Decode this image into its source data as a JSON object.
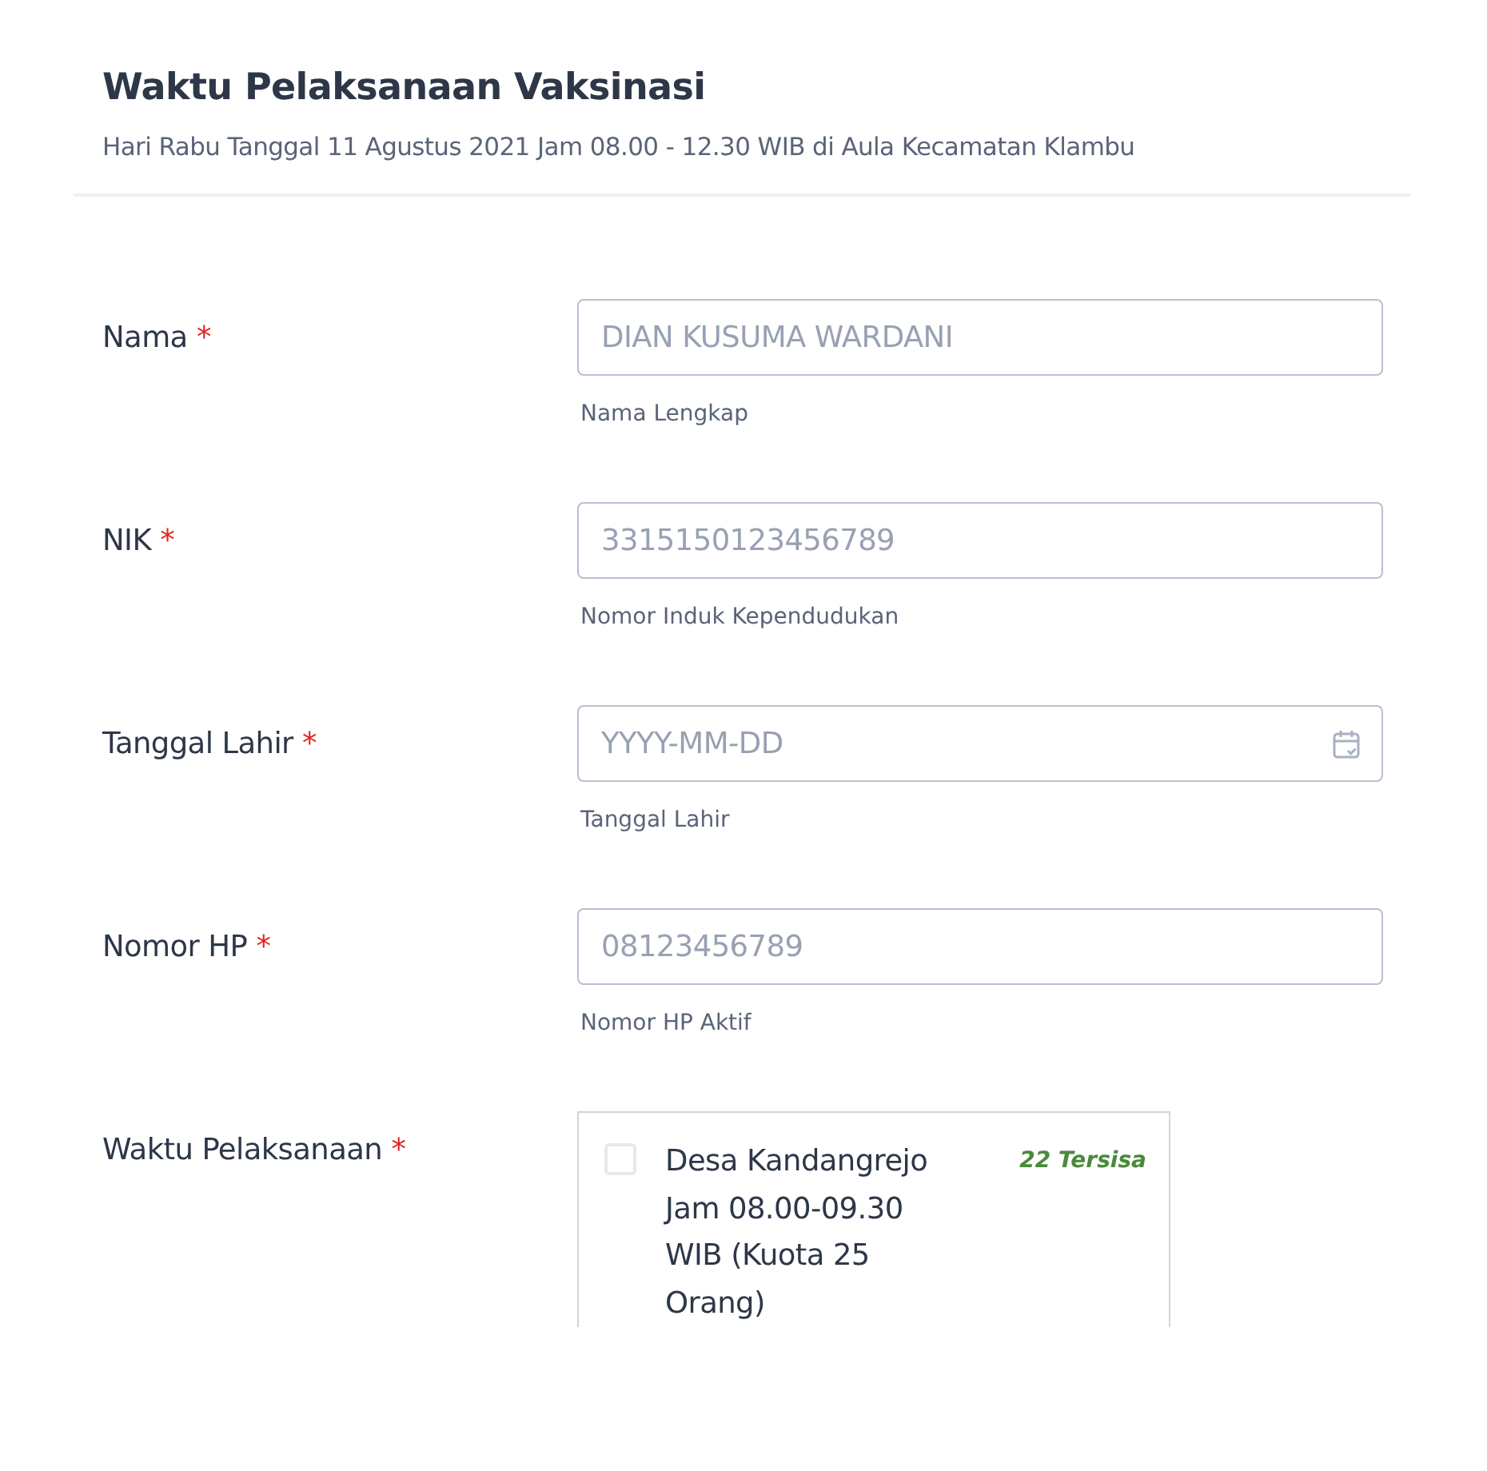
{
  "header": {
    "title": "Waktu Pelaksanaan Vaksinasi",
    "subtitle": "Hari Rabu Tanggal 11 Agustus 2021 Jam 08.00 - 12.30 WIB di Aula Kecamatan Klambu"
  },
  "fields": [
    {
      "kind": "text",
      "label": "Nama",
      "required_mark": "*",
      "placeholder": "DIAN KUSUMA WARDANI",
      "hint": "Nama Lengkap"
    },
    {
      "kind": "text",
      "label": "NIK",
      "required_mark": "*",
      "placeholder": "3315150123456789",
      "hint": "Nomor Induk Kependudukan"
    },
    {
      "kind": "date",
      "label": "Tanggal Lahir",
      "required_mark": "*",
      "placeholder": "YYYY-MM-DD",
      "hint": "Tanggal Lahir"
    },
    {
      "kind": "text",
      "label": "Nomor HP",
      "required_mark": "*",
      "placeholder": "08123456789",
      "hint": "Nomor HP Aktif"
    }
  ],
  "schedule": {
    "label": "Waktu Pelaksanaan",
    "required_mark": "*",
    "options": [
      {
        "label": "Desa Kandangrejo Jam 08.00-09.30 WIB (Kuota 25 Orang)",
        "remaining": "22 Tersisa",
        "checked": false
      }
    ]
  }
}
